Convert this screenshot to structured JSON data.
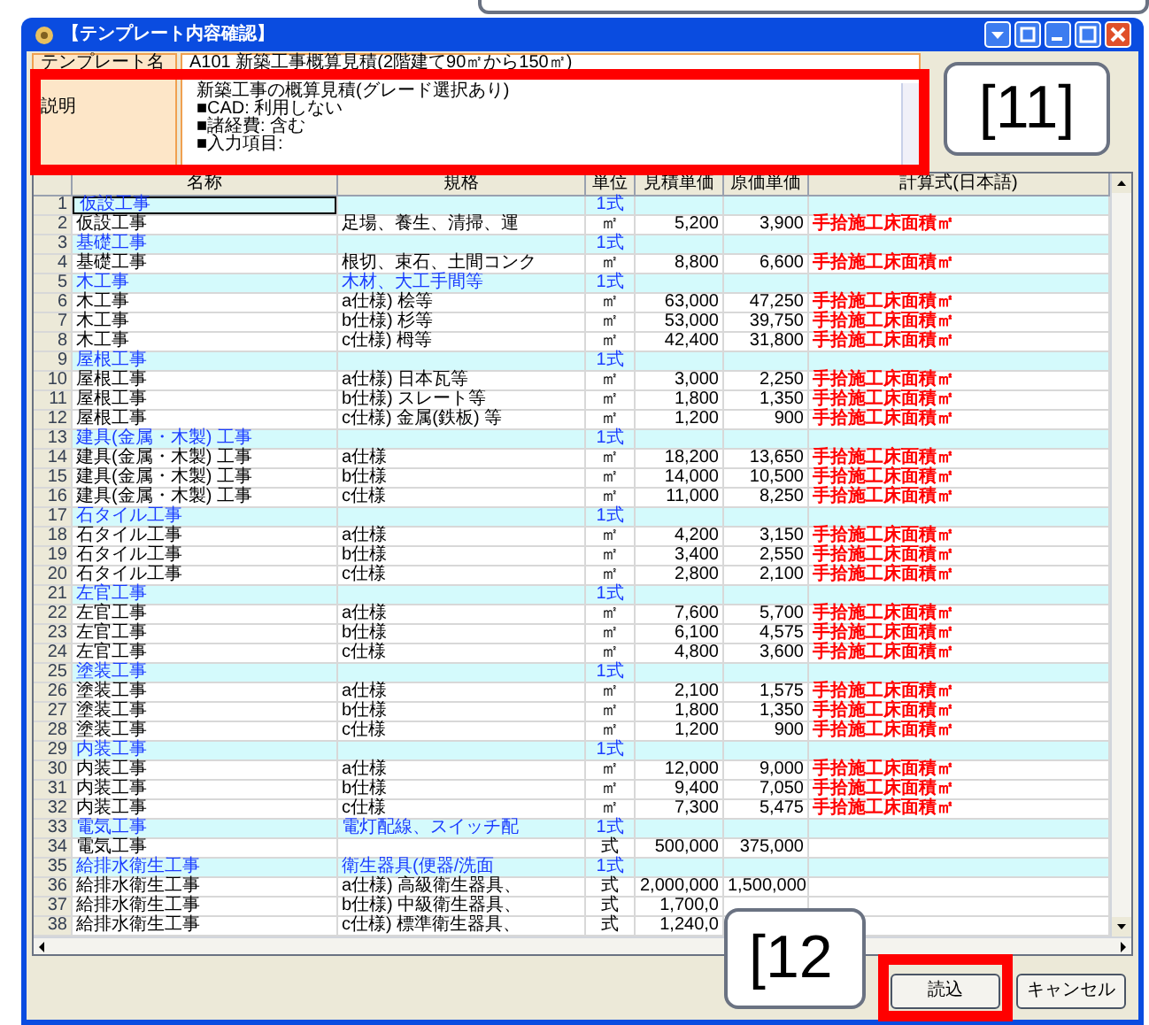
{
  "window": {
    "title": "【テンプレート内容確認】"
  },
  "template": {
    "label": "テンプレート名",
    "value": "A101 新築工事概算見積(2階建て90㎡から150㎡)"
  },
  "description": {
    "label": "説明",
    "lines": [
      "新築工事の概算見積(グレード選択あり)",
      "■CAD: 利用しない",
      "■諸経費: 含む",
      "■入力項目:"
    ]
  },
  "callouts": [
    {
      "text": "[11]"
    },
    {
      "text": "[12"
    }
  ],
  "table": {
    "columns": [
      "名称",
      "規格",
      "単位",
      "見積単価",
      "原価単価",
      "計算式(日本語)"
    ],
    "rows": [
      {
        "kind": "group",
        "no": "1",
        "name": "仮設工事",
        "spec": "",
        "unit": "1式",
        "est": "",
        "cost": "",
        "formula": "",
        "selected": true
      },
      {
        "kind": "item",
        "no": "2",
        "name": "仮設工事",
        "spec": "足場、養生、清掃、運",
        "unit": "㎡",
        "est": "5,200",
        "cost": "3,900",
        "formula": "手拾施工床面積㎡",
        "selected": false
      },
      {
        "kind": "group",
        "no": "3",
        "name": "基礎工事",
        "spec": "",
        "unit": "1式",
        "est": "",
        "cost": "",
        "formula": "",
        "selected": false
      },
      {
        "kind": "item",
        "no": "4",
        "name": "基礎工事",
        "spec": "根切、束石、土間コンク",
        "unit": "㎡",
        "est": "8,800",
        "cost": "6,600",
        "formula": "手拾施工床面積㎡",
        "selected": false
      },
      {
        "kind": "group",
        "no": "5",
        "name": "木工事",
        "spec": "木材、大工手間等",
        "unit": "1式",
        "est": "",
        "cost": "",
        "formula": "",
        "selected": false
      },
      {
        "kind": "item",
        "no": "6",
        "name": "木工事",
        "spec": "a仕様) 桧等",
        "unit": "㎡",
        "est": "63,000",
        "cost": "47,250",
        "formula": "手拾施工床面積㎡",
        "selected": false
      },
      {
        "kind": "item",
        "no": "7",
        "name": "木工事",
        "spec": "b仕様) 杉等",
        "unit": "㎡",
        "est": "53,000",
        "cost": "39,750",
        "formula": "手拾施工床面積㎡",
        "selected": false
      },
      {
        "kind": "item",
        "no": "8",
        "name": "木工事",
        "spec": "c仕様) 栂等",
        "unit": "㎡",
        "est": "42,400",
        "cost": "31,800",
        "formula": "手拾施工床面積㎡",
        "selected": false
      },
      {
        "kind": "group",
        "no": "9",
        "name": "屋根工事",
        "spec": "",
        "unit": "1式",
        "est": "",
        "cost": "",
        "formula": "",
        "selected": false
      },
      {
        "kind": "item",
        "no": "10",
        "name": "屋根工事",
        "spec": "a仕様) 日本瓦等",
        "unit": "㎡",
        "est": "3,000",
        "cost": "2,250",
        "formula": "手拾施工床面積㎡",
        "selected": false
      },
      {
        "kind": "item",
        "no": "11",
        "name": "屋根工事",
        "spec": "b仕様) スレート等",
        "unit": "㎡",
        "est": "1,800",
        "cost": "1,350",
        "formula": "手拾施工床面積㎡",
        "selected": false
      },
      {
        "kind": "item",
        "no": "12",
        "name": "屋根工事",
        "spec": "c仕様) 金属(鉄板) 等",
        "unit": "㎡",
        "est": "1,200",
        "cost": "900",
        "formula": "手拾施工床面積㎡",
        "selected": false
      },
      {
        "kind": "group",
        "no": "13",
        "name": "建具(金属・木製) 工事",
        "spec": "",
        "unit": "1式",
        "est": "",
        "cost": "",
        "formula": "",
        "selected": false
      },
      {
        "kind": "item",
        "no": "14",
        "name": "建具(金属・木製) 工事",
        "spec": "a仕様",
        "unit": "㎡",
        "est": "18,200",
        "cost": "13,650",
        "formula": "手拾施工床面積㎡",
        "selected": false
      },
      {
        "kind": "item",
        "no": "15",
        "name": "建具(金属・木製) 工事",
        "spec": "b仕様",
        "unit": "㎡",
        "est": "14,000",
        "cost": "10,500",
        "formula": "手拾施工床面積㎡",
        "selected": false
      },
      {
        "kind": "item",
        "no": "16",
        "name": "建具(金属・木製) 工事",
        "spec": "c仕様",
        "unit": "㎡",
        "est": "11,000",
        "cost": "8,250",
        "formula": "手拾施工床面積㎡",
        "selected": false
      },
      {
        "kind": "group",
        "no": "17",
        "name": "石タイル工事",
        "spec": "",
        "unit": "1式",
        "est": "",
        "cost": "",
        "formula": "",
        "selected": false
      },
      {
        "kind": "item",
        "no": "18",
        "name": "石タイル工事",
        "spec": "a仕様",
        "unit": "㎡",
        "est": "4,200",
        "cost": "3,150",
        "formula": "手拾施工床面積㎡",
        "selected": false
      },
      {
        "kind": "item",
        "no": "19",
        "name": "石タイル工事",
        "spec": "b仕様",
        "unit": "㎡",
        "est": "3,400",
        "cost": "2,550",
        "formula": "手拾施工床面積㎡",
        "selected": false
      },
      {
        "kind": "item",
        "no": "20",
        "name": "石タイル工事",
        "spec": "c仕様",
        "unit": "㎡",
        "est": "2,800",
        "cost": "2,100",
        "formula": "手拾施工床面積㎡",
        "selected": false
      },
      {
        "kind": "group",
        "no": "21",
        "name": "左官工事",
        "spec": "",
        "unit": "1式",
        "est": "",
        "cost": "",
        "formula": "",
        "selected": false
      },
      {
        "kind": "item",
        "no": "22",
        "name": "左官工事",
        "spec": "a仕様",
        "unit": "㎡",
        "est": "7,600",
        "cost": "5,700",
        "formula": "手拾施工床面積㎡",
        "selected": false
      },
      {
        "kind": "item",
        "no": "23",
        "name": "左官工事",
        "spec": "b仕様",
        "unit": "㎡",
        "est": "6,100",
        "cost": "4,575",
        "formula": "手拾施工床面積㎡",
        "selected": false
      },
      {
        "kind": "item",
        "no": "24",
        "name": "左官工事",
        "spec": "c仕様",
        "unit": "㎡",
        "est": "4,800",
        "cost": "3,600",
        "formula": "手拾施工床面積㎡",
        "selected": false
      },
      {
        "kind": "group",
        "no": "25",
        "name": "塗装工事",
        "spec": "",
        "unit": "1式",
        "est": "",
        "cost": "",
        "formula": "",
        "selected": false
      },
      {
        "kind": "item",
        "no": "26",
        "name": "塗装工事",
        "spec": "a仕様",
        "unit": "㎡",
        "est": "2,100",
        "cost": "1,575",
        "formula": "手拾施工床面積㎡",
        "selected": false
      },
      {
        "kind": "item",
        "no": "27",
        "name": "塗装工事",
        "spec": "b仕様",
        "unit": "㎡",
        "est": "1,800",
        "cost": "1,350",
        "formula": "手拾施工床面積㎡",
        "selected": false
      },
      {
        "kind": "item",
        "no": "28",
        "name": "塗装工事",
        "spec": "c仕様",
        "unit": "㎡",
        "est": "1,200",
        "cost": "900",
        "formula": "手拾施工床面積㎡",
        "selected": false
      },
      {
        "kind": "group",
        "no": "29",
        "name": "内装工事",
        "spec": "",
        "unit": "1式",
        "est": "",
        "cost": "",
        "formula": "",
        "selected": false
      },
      {
        "kind": "item",
        "no": "30",
        "name": "内装工事",
        "spec": "a仕様",
        "unit": "㎡",
        "est": "12,000",
        "cost": "9,000",
        "formula": "手拾施工床面積㎡",
        "selected": false
      },
      {
        "kind": "item",
        "no": "31",
        "name": "内装工事",
        "spec": "b仕様",
        "unit": "㎡",
        "est": "9,400",
        "cost": "7,050",
        "formula": "手拾施工床面積㎡",
        "selected": false
      },
      {
        "kind": "item",
        "no": "32",
        "name": "内装工事",
        "spec": "c仕様",
        "unit": "㎡",
        "est": "7,300",
        "cost": "5,475",
        "formula": "手拾施工床面積㎡",
        "selected": false
      },
      {
        "kind": "group",
        "no": "33",
        "name": "電気工事",
        "spec": "電灯配線、スイッチ配",
        "unit": "1式",
        "est": "",
        "cost": "",
        "formula": "",
        "selected": false
      },
      {
        "kind": "item",
        "no": "34",
        "name": "電気工事",
        "spec": "",
        "unit": "式",
        "est": "500,000",
        "cost": "375,000",
        "formula": "",
        "selected": false
      },
      {
        "kind": "group",
        "no": "35",
        "name": "給排水衛生工事",
        "spec": "衛生器具(便器/洗面",
        "unit": "1式",
        "est": "",
        "cost": "",
        "formula": "",
        "selected": false
      },
      {
        "kind": "item",
        "no": "36",
        "name": "給排水衛生工事",
        "spec": "a仕様) 高級衛生器具、",
        "unit": "式",
        "est": "2,000,000",
        "cost": "1,500,000",
        "formula": "",
        "selected": false
      },
      {
        "kind": "item",
        "no": "37",
        "name": "給排水衛生工事",
        "spec": "b仕様) 中級衛生器具、",
        "unit": "式",
        "est": "1,700,0",
        "cost": "",
        "formula": "",
        "selected": false
      },
      {
        "kind": "item",
        "no": "38",
        "name": "給排水衛生工事",
        "spec": "c仕様) 標準衛生器具、",
        "unit": "式",
        "est": "1,240,0",
        "cost": "",
        "formula": "",
        "selected": false
      }
    ]
  },
  "buttons": [
    {
      "label": "読込"
    },
    {
      "label": "キャンセル"
    }
  ]
}
